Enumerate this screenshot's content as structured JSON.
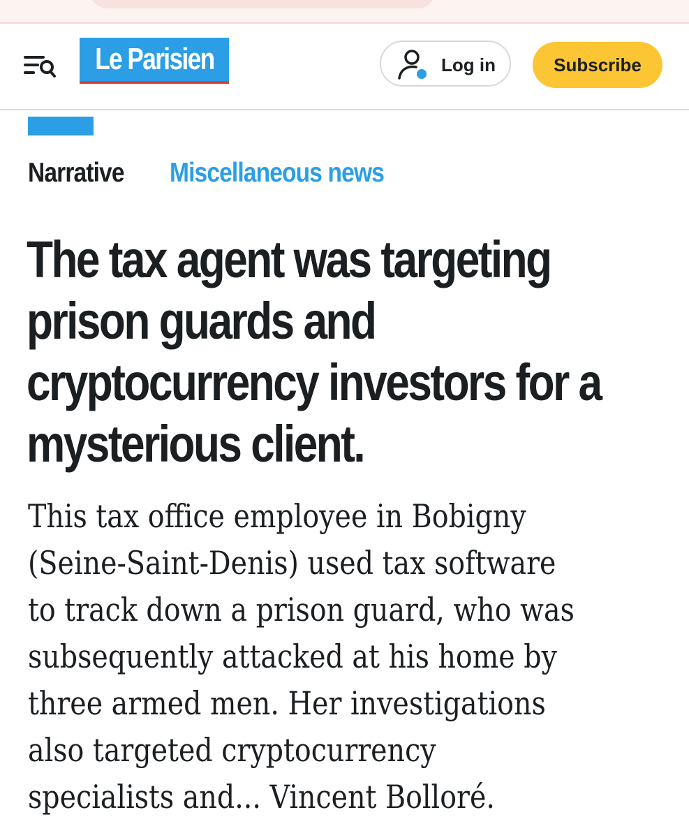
{
  "header": {
    "logo_text": "Le Parisien",
    "login_label": "Log in",
    "subscribe_label": "Subscribe"
  },
  "article": {
    "kind": "Narrative",
    "section": "Miscellaneous news",
    "headline": "The tax agent was targeting\nprison guards and\ncryptocurrency investors for a\nmysterious client.",
    "lede": "This tax office employee in Bobigny\n(Seine-Saint-Denis) used tax software\nto track down a prison guard, who was\nsubsequently attacked at his home by\nthree armed men. Her investigations\nalso targeted cryptocurrency\nspecialists and... Vincent Bolloré."
  },
  "icons": {
    "menu": "menu-search-icon",
    "user": "user-icon"
  },
  "colors": {
    "brand_blue": "#2b9ee5",
    "subscribe_yellow": "#fcc533",
    "logo_underline": "#e23b3b",
    "text": "#1b1f22"
  }
}
